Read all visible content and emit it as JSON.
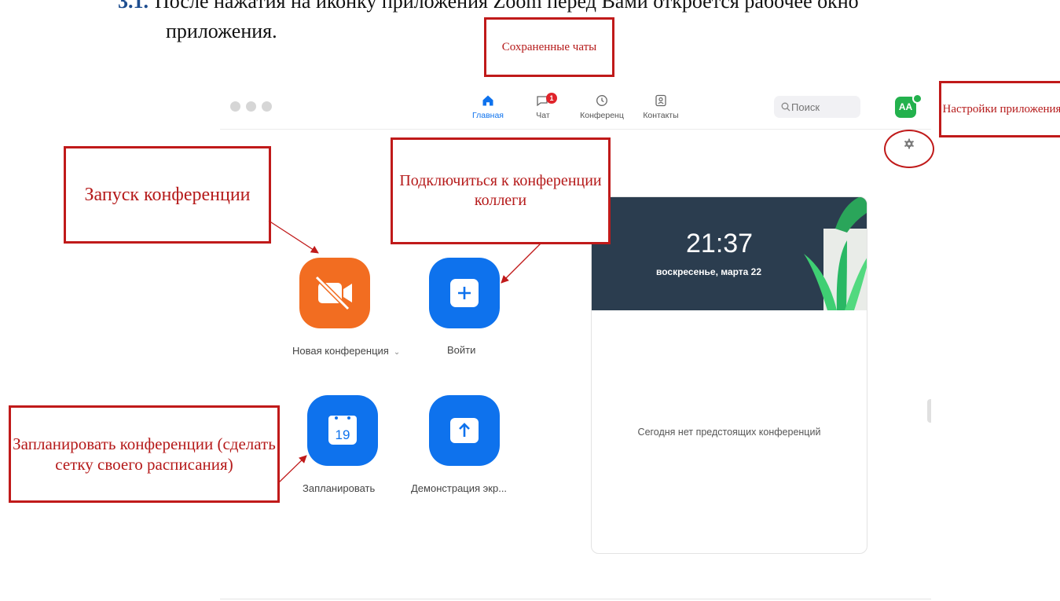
{
  "document": {
    "step_number": "3.1.",
    "line1": "После нажатия на иконку приложения Zoom перед Вами откроется рабочее окно",
    "line2": "приложения."
  },
  "app": {
    "nav": [
      {
        "label": "Главная",
        "icon": "home-icon",
        "active": true
      },
      {
        "label": "Чат",
        "icon": "chat-icon",
        "badge": "1"
      },
      {
        "label": "Конференц",
        "icon": "clock-icon"
      },
      {
        "label": "Контакты",
        "icon": "contacts-icon"
      }
    ],
    "search": {
      "placeholder": "Поиск"
    },
    "avatar": {
      "initials": "AA"
    },
    "tiles": [
      {
        "label": "Новая конференция",
        "icon": "video-off-icon",
        "color": "#f26d21"
      },
      {
        "label": "Войти",
        "icon": "plus-icon",
        "color": "#0e72ed"
      },
      {
        "label": "Запланировать",
        "icon": "calendar-icon",
        "day": "19",
        "color": "#0e72ed"
      },
      {
        "label": "Демонстрация экр...",
        "icon": "share-screen-icon",
        "color": "#0e72ed"
      }
    ],
    "card": {
      "time": "21:37",
      "date": "воскресенье, марта 22",
      "empty_text": "Сегодня нет предстоящих конференций"
    }
  },
  "annotations": {
    "saved_chats": "Сохраненные чаты",
    "settings": "Настройки приложения",
    "start": "Запуск конференции",
    "join": "Подключиться к конференции коллеги",
    "schedule": "Запланировать конференции (сделать сетку своего расписания)"
  },
  "colors": {
    "accent": "#0e72ed",
    "annotation": "#c01a1a"
  }
}
